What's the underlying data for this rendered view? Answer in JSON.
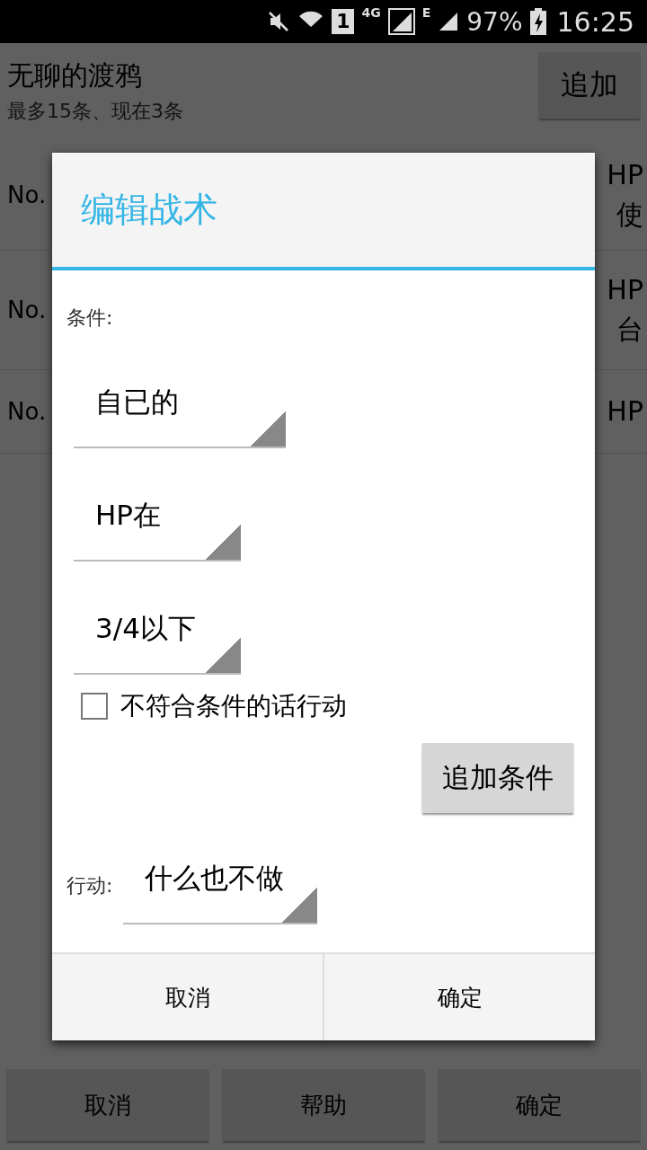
{
  "status_bar": {
    "sim": "1",
    "network": "4G",
    "network_2": "E",
    "battery": "97%",
    "time": "16:25"
  },
  "header": {
    "title": "无聊的渡鸦",
    "subtitle": "最多15条、现在3条",
    "add_button": "追加"
  },
  "rows": [
    {
      "number": "No.",
      "lines": [
        "HP",
        "使"
      ]
    },
    {
      "number": "No.",
      "lines": [
        "HP",
        "台"
      ]
    },
    {
      "number": "No.",
      "lines": [
        "HP"
      ]
    }
  ],
  "dialog": {
    "title": "编辑战术",
    "condition_label": "条件:",
    "spinners": [
      {
        "value": "自已的"
      },
      {
        "value": "HP在"
      },
      {
        "value": "3/4以下"
      }
    ],
    "checkbox": {
      "label": "不符合条件的话行动",
      "checked": false
    },
    "add_condition_button": "追加条件",
    "action_label": "行动:",
    "action_value": "什么也不做",
    "buttons": [
      "取消",
      "确定"
    ]
  },
  "bottom_buttons": [
    "取消",
    "帮助",
    "确定"
  ]
}
